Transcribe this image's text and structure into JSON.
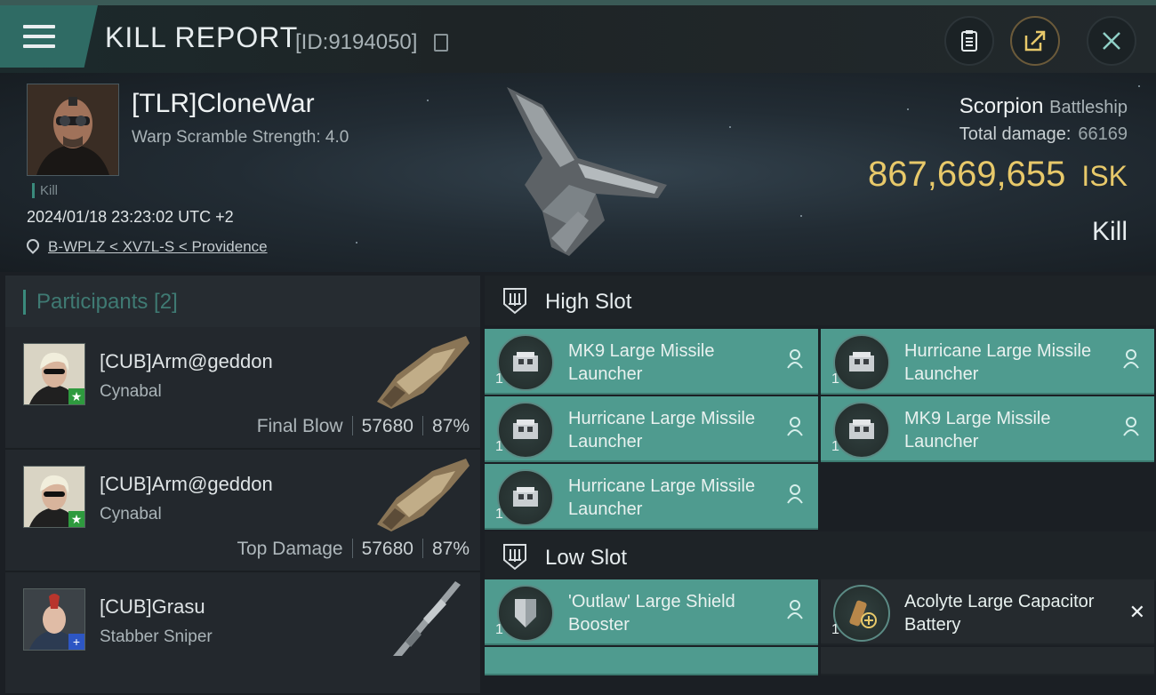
{
  "header": {
    "title": "KILL REPORT",
    "report_id": "[ID:9194050]",
    "icons": {
      "menu": "hamburger-icon",
      "copy": "copy-icon",
      "clipboard": "clipboard-icon",
      "share": "share-icon",
      "close": "close-icon"
    }
  },
  "victim": {
    "name": "[TLR]CloneWar",
    "warp_scramble": "Warp Scramble Strength: 4.0",
    "tag": "Kill",
    "timestamp": "2024/01/18 23:23:02 UTC +2",
    "location": "B-WPLZ < XV7L-S < Providence",
    "ship_name": "Scorpion",
    "ship_class": "Battleship",
    "total_damage_label": "Total damage:",
    "total_damage": "66169",
    "isk_value": "867,669,655",
    "isk_unit": "ISK",
    "result": "Kill"
  },
  "participants": {
    "label": "Participants [2]",
    "rows": [
      {
        "name": "[CUB]Arm@geddon",
        "ship": "Cynabal",
        "role": "Final Blow",
        "damage": "57680",
        "percent": "87%",
        "badge": "★"
      },
      {
        "name": "[CUB]Arm@geddon",
        "ship": "Cynabal",
        "role": "Top Damage",
        "damage": "57680",
        "percent": "87%",
        "badge": "★"
      },
      {
        "name": "[CUB]Grasu",
        "ship": "Stabber Sniper",
        "role": "",
        "damage": "",
        "percent": "",
        "badge": "+"
      }
    ]
  },
  "fitting": {
    "high_slot_label": "High Slot",
    "low_slot_label": "Low Slot",
    "high": [
      {
        "name": "MK9 Large Missile Launcher",
        "qty": "1"
      },
      {
        "name": "Hurricane Large Missile Launcher",
        "qty": "1"
      },
      {
        "name": "Hurricane Large Missile Launcher",
        "qty": "1"
      },
      {
        "name": "MK9 Large Missile Launcher",
        "qty": "1"
      },
      {
        "name": "Hurricane Large Missile Launcher",
        "qty": "1"
      }
    ],
    "low": [
      {
        "name": "'Outlaw' Large Shield Booster",
        "qty": "1"
      },
      {
        "name": "Acolyte Large Capacitor Battery",
        "qty": "1"
      }
    ]
  },
  "colors": {
    "accent": "#4f9b8f",
    "isk": "#e8c96a",
    "header_button": "#2f6b64"
  }
}
